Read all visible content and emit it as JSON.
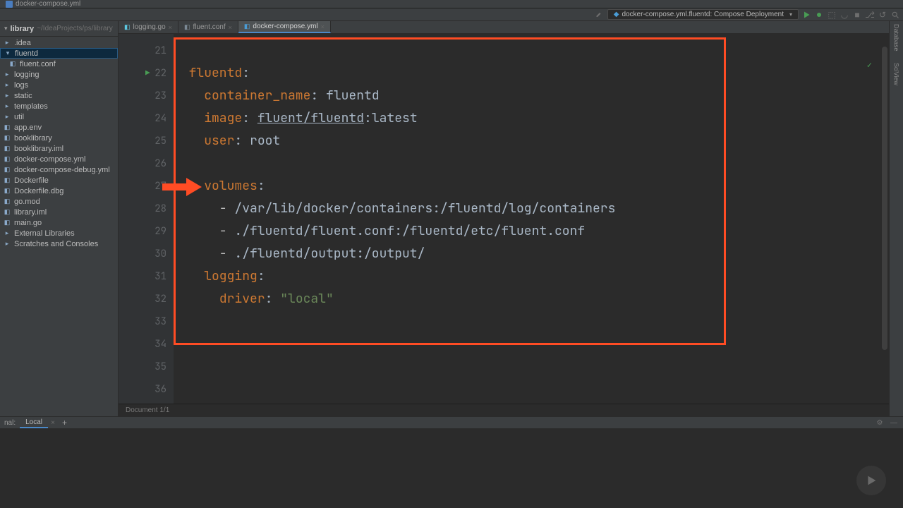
{
  "titleBar": {
    "filename": "docker-compose.yml"
  },
  "runConfig": {
    "label": "docker-compose.yml.fluentd: Compose Deployment"
  },
  "projectPanel": {
    "name": "library",
    "path": "~/IdeaProjects/ps/library",
    "tree": [
      {
        "label": ".idea",
        "type": "folder",
        "indent": 0
      },
      {
        "label": "fluentd",
        "type": "folder",
        "indent": 0,
        "selected": true
      },
      {
        "label": "fluent.conf",
        "type": "file",
        "indent": 1
      },
      {
        "label": "logging",
        "type": "folder",
        "indent": 0
      },
      {
        "label": "logs",
        "type": "folder",
        "indent": 0
      },
      {
        "label": "static",
        "type": "folder",
        "indent": 0
      },
      {
        "label": "templates",
        "type": "folder",
        "indent": 0
      },
      {
        "label": "util",
        "type": "folder",
        "indent": 0
      },
      {
        "label": "app.env",
        "type": "file",
        "indent": 0
      },
      {
        "label": "booklibrary",
        "type": "file",
        "indent": 0
      },
      {
        "label": "booklibrary.iml",
        "type": "file",
        "indent": 0
      },
      {
        "label": "docker-compose.yml",
        "type": "file",
        "indent": 0
      },
      {
        "label": "docker-compose-debug.yml",
        "type": "file",
        "indent": 0
      },
      {
        "label": "Dockerfile",
        "type": "file",
        "indent": 0
      },
      {
        "label": "Dockerfile.dbg",
        "type": "file",
        "indent": 0
      },
      {
        "label": "go.mod",
        "type": "file",
        "indent": 0
      },
      {
        "label": "library.iml",
        "type": "file",
        "indent": 0
      },
      {
        "label": "main.go",
        "type": "file",
        "indent": 0
      }
    ],
    "externalLibraries": "External Libraries",
    "scratches": "Scratches and Consoles"
  },
  "tabs": [
    {
      "name": "logging.go",
      "iconClass": "go-icon",
      "active": false
    },
    {
      "name": "fluent.conf",
      "iconClass": "conf-icon",
      "active": false
    },
    {
      "name": "docker-compose.yml",
      "iconClass": "yml-icon",
      "active": true
    }
  ],
  "editor": {
    "startLine": 21,
    "endLine": 36,
    "gutterPlayLine": 22,
    "arrowLine": 27,
    "statusText": "Document 1/1",
    "lines": {
      "21": "",
      "22": {
        "indent": "  ",
        "key": "fluentd",
        "colon": ":"
      },
      "23": {
        "indent": "    ",
        "key": "container_name",
        "colon": ": ",
        "val": "fluentd"
      },
      "24": {
        "indent": "    ",
        "key": "image",
        "colon": ": ",
        "link": "fluent/fluentd",
        "suffix": ":latest"
      },
      "25": {
        "indent": "    ",
        "key": "user",
        "colon": ": ",
        "val": "root"
      },
      "26": "",
      "27": {
        "indent": "    ",
        "key": "volumes",
        "colon": ":"
      },
      "28": {
        "indent": "      - ",
        "val": "/var/lib/docker/containers:/fluentd/log/containers"
      },
      "29": {
        "indent": "      - ",
        "val": "./fluentd/fluent.conf:/fluentd/etc/fluent.conf"
      },
      "30": {
        "indent": "      - ",
        "val": "./fluentd/output:/output/"
      },
      "31": {
        "indent": "    ",
        "key": "logging",
        "colon": ":"
      },
      "32": {
        "indent": "      ",
        "key": "driver",
        "colon": ": ",
        "str": "\"local\""
      },
      "33": "",
      "34": "",
      "35": "",
      "36": ""
    }
  },
  "rightRail": {
    "items": [
      "Database",
      "SciView"
    ]
  },
  "terminal": {
    "titleLabel": "nal:",
    "activeTab": "Local"
  },
  "icons": {
    "close": "×",
    "add": "+",
    "chevron": "▾",
    "gear": "⚙",
    "minimize": "—",
    "search": "🔍"
  }
}
